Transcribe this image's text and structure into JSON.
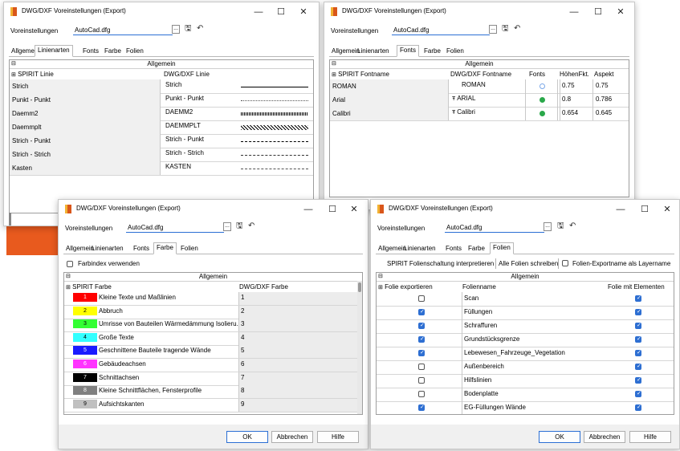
{
  "window_title": "DWG/DXF Voreinstellungen (Export)",
  "window_controls": {
    "minimize": "—",
    "maximize": "☐",
    "close": "✕"
  },
  "preset": {
    "label": "Voreinstellungen",
    "value": "AutoCad.dfg",
    "dots": "..."
  },
  "tabs": [
    "Allgemein",
    "Linienarten",
    "Fonts",
    "Farbe",
    "Folien"
  ],
  "group_label": "Allgemein",
  "buttons": {
    "ok": "OK",
    "cancel": "Abbrechen",
    "help": "Hilfe"
  },
  "colors": {
    "accent": "#2b6fd4",
    "orange": "#e85a1e",
    "check_blue": "#2e6fd2",
    "font_green": "#2aa84a"
  },
  "lines": {
    "col_spirit": "SPIRIT Linie",
    "col_dwg": "DWG/DXF Linie",
    "rows": [
      {
        "spirit": "Strich",
        "dwg": "Strich",
        "pattern": "solid"
      },
      {
        "spirit": "Punkt - Punkt",
        "dwg": "Punkt - Punkt",
        "pattern": "dotted"
      },
      {
        "spirit": "Daemm2",
        "dwg": "DAEMM2",
        "pattern": "zigzag"
      },
      {
        "spirit": "Daemmplt",
        "dwg": "DAEMMPLT",
        "pattern": "zigzag2"
      },
      {
        "spirit": "Strich - Punkt",
        "dwg": "Strich - Punkt",
        "pattern": "dashdot"
      },
      {
        "spirit": "Strich - Strich",
        "dwg": "Strich - Strich",
        "pattern": "dashed"
      },
      {
        "spirit": "Kasten",
        "dwg": "KASTEN",
        "pattern": "box"
      }
    ]
  },
  "fonts": {
    "col_spirit": "SPIRIT Fontname",
    "col_dwg": "DWG/DXF Fontname",
    "col_fonts": "Fonts",
    "col_height": "HöhenFkt.",
    "col_aspect": "Aspekt",
    "rows": [
      {
        "spirit": "ROMAN",
        "dwg": "ROMAN",
        "truetype": false,
        "installed": false,
        "height": "0.75",
        "aspect": "0.75"
      },
      {
        "spirit": "Arial",
        "dwg": "ARIAL",
        "truetype": true,
        "installed": true,
        "height": "0.8",
        "aspect": "0.786"
      },
      {
        "spirit": "Calibri",
        "dwg": "Calibri",
        "truetype": true,
        "installed": true,
        "height": "0.654",
        "aspect": "0.645"
      }
    ]
  },
  "farbe": {
    "checkbox_label": "Farbindex verwenden",
    "col_spirit": "SPIRIT Farbe",
    "col_dwg": "DWG/DXF Farbe",
    "rows": [
      {
        "index": "1",
        "color": "#ff0000",
        "name": "Kleine Texte und Maßlinien",
        "dwg": "1"
      },
      {
        "index": "2",
        "color": "#ffff00",
        "name": "Abbruch",
        "dwg": "2"
      },
      {
        "index": "3",
        "color": "#33ff33",
        "name": "Umrisse von Bauteilen Wärmedämmung Isolieru...",
        "dwg": "3"
      },
      {
        "index": "4",
        "color": "#33ffff",
        "name": "Große Texte",
        "dwg": "4"
      },
      {
        "index": "5",
        "color": "#1a1aff",
        "name": "Geschnittene Bauteile tragende Wände",
        "dwg": "5"
      },
      {
        "index": "6",
        "color": "#ff33ff",
        "name": "Gebäudeachsen",
        "dwg": "6"
      },
      {
        "index": "7",
        "color": "#000000",
        "name": "Schnittachsen",
        "dwg": "7"
      },
      {
        "index": "8",
        "color": "#808080",
        "name": "Kleine Schnittflächen, Fensterprofile",
        "dwg": "8"
      },
      {
        "index": "9",
        "color": "#c0c0c0",
        "name": "Aufsichtskanten",
        "dwg": "9"
      }
    ]
  },
  "folien": {
    "toolbar_interpret": "SPIRIT Folienschaltung interpretieren",
    "toolbar_write_all": "Alle Folien schreiben",
    "toolbar_layername": "Folien-Exportname als Layername",
    "col_export": "Folie exportieren",
    "col_name": "Folienname",
    "col_elements": "Folie mit Elementen",
    "rows": [
      {
        "export": false,
        "name": "Scan",
        "elements": true
      },
      {
        "export": true,
        "name": "Füllungen",
        "elements": true
      },
      {
        "export": true,
        "name": "Schraffuren",
        "elements": true
      },
      {
        "export": true,
        "name": "Grundstücksgrenze",
        "elements": true
      },
      {
        "export": true,
        "name": "Lebewesen_Fahrzeuge_Vegetation",
        "elements": true
      },
      {
        "export": false,
        "name": "Außenbereich",
        "elements": true
      },
      {
        "export": false,
        "name": "Hilfslinien",
        "elements": true
      },
      {
        "export": false,
        "name": "Bodenplatte",
        "elements": true
      },
      {
        "export": true,
        "name": "EG-Füllungen Wände",
        "elements": true
      }
    ]
  }
}
